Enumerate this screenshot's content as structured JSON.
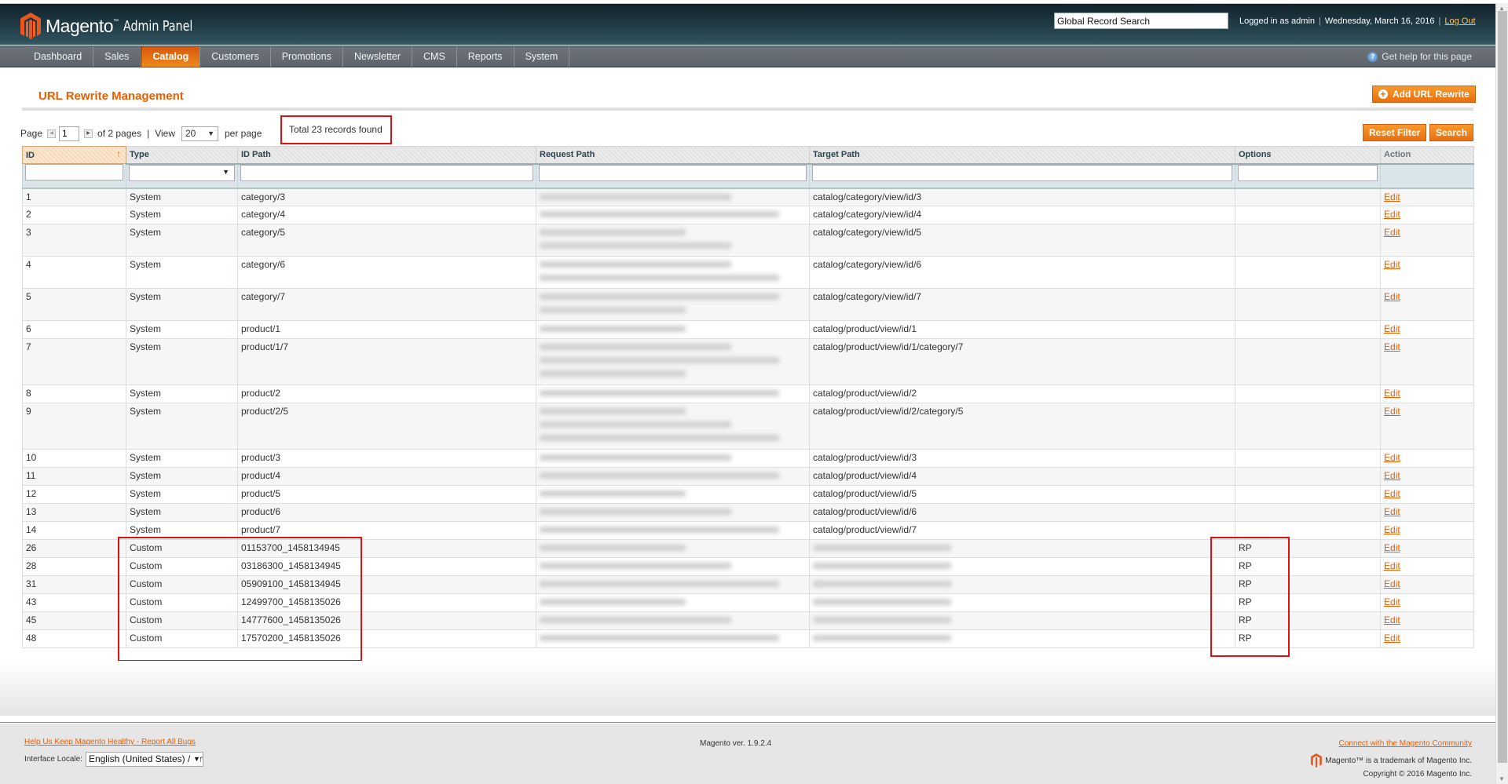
{
  "header": {
    "brand": "Magento",
    "brand_sub": "Admin Panel",
    "global_search_value": "Global Record Search",
    "logged_in": "Logged in as admin",
    "date": "Wednesday, March 16, 2016",
    "logout": "Log Out"
  },
  "nav": {
    "items": [
      {
        "label": "Dashboard"
      },
      {
        "label": "Sales"
      },
      {
        "label": "Catalog",
        "active": true
      },
      {
        "label": "Customers"
      },
      {
        "label": "Promotions"
      },
      {
        "label": "Newsletter"
      },
      {
        "label": "CMS"
      },
      {
        "label": "Reports"
      },
      {
        "label": "System"
      }
    ],
    "help": "Get help for this page"
  },
  "page": {
    "title": "URL Rewrite Management",
    "add_button": "Add URL Rewrite",
    "reset_filter": "Reset Filter",
    "search": "Search"
  },
  "pager": {
    "page_label": "Page",
    "page_value": "1",
    "of_pages": "of 2 pages",
    "view_label": "View",
    "per_page_value": "20",
    "per_page_label": "per page",
    "total": "Total 23 records found"
  },
  "grid": {
    "columns": [
      "ID",
      "Type",
      "ID Path",
      "Request Path",
      "Target Path",
      "Options",
      "Action"
    ],
    "rows": [
      {
        "id": "1",
        "type": "System",
        "id_path": "category/3",
        "request_path": "[blurred]",
        "target_path": "catalog/category/view/id/3",
        "options": "",
        "action": "Edit"
      },
      {
        "id": "2",
        "type": "System",
        "id_path": "category/4",
        "request_path": "[blurred]",
        "target_path": "catalog/category/view/id/4",
        "options": "",
        "action": "Edit"
      },
      {
        "id": "3",
        "type": "System",
        "id_path": "category/5",
        "request_path": "[blurred]",
        "target_path": "catalog/category/view/id/5",
        "options": "",
        "action": "Edit"
      },
      {
        "id": "4",
        "type": "System",
        "id_path": "category/6",
        "request_path": "[blurred]",
        "target_path": "catalog/category/view/id/6",
        "options": "",
        "action": "Edit"
      },
      {
        "id": "5",
        "type": "System",
        "id_path": "category/7",
        "request_path": "[blurred]",
        "target_path": "catalog/category/view/id/7",
        "options": "",
        "action": "Edit"
      },
      {
        "id": "6",
        "type": "System",
        "id_path": "product/1",
        "request_path": "[blurred]",
        "target_path": "catalog/product/view/id/1",
        "options": "",
        "action": "Edit"
      },
      {
        "id": "7",
        "type": "System",
        "id_path": "product/1/7",
        "request_path": "[blurred]",
        "target_path": "catalog/product/view/id/1/category/7",
        "options": "",
        "action": "Edit"
      },
      {
        "id": "8",
        "type": "System",
        "id_path": "product/2",
        "request_path": "[blurred]",
        "target_path": "catalog/product/view/id/2",
        "options": "",
        "action": "Edit"
      },
      {
        "id": "9",
        "type": "System",
        "id_path": "product/2/5",
        "request_path": "[blurred]",
        "target_path": "catalog/product/view/id/2/category/5",
        "options": "",
        "action": "Edit"
      },
      {
        "id": "10",
        "type": "System",
        "id_path": "product/3",
        "request_path": "[blurred]",
        "target_path": "catalog/product/view/id/3",
        "options": "",
        "action": "Edit"
      },
      {
        "id": "11",
        "type": "System",
        "id_path": "product/4",
        "request_path": "[blurred]",
        "target_path": "catalog/product/view/id/4",
        "options": "",
        "action": "Edit"
      },
      {
        "id": "12",
        "type": "System",
        "id_path": "product/5",
        "request_path": "[blurred]",
        "target_path": "catalog/product/view/id/5",
        "options": "",
        "action": "Edit"
      },
      {
        "id": "13",
        "type": "System",
        "id_path": "product/6",
        "request_path": "[blurred]",
        "target_path": "catalog/product/view/id/6",
        "options": "",
        "action": "Edit"
      },
      {
        "id": "14",
        "type": "System",
        "id_path": "product/7",
        "request_path": "[blurred]",
        "target_path": "catalog/product/view/id/7",
        "options": "",
        "action": "Edit"
      },
      {
        "id": "26",
        "type": "Custom",
        "id_path": "01153700_1458134945",
        "request_path": "[blurred]",
        "target_path": "[blurred]",
        "options": "RP",
        "action": "Edit"
      },
      {
        "id": "28",
        "type": "Custom",
        "id_path": "03186300_1458134945",
        "request_path": "[blurred]",
        "target_path": "[blurred]",
        "options": "RP",
        "action": "Edit"
      },
      {
        "id": "31",
        "type": "Custom",
        "id_path": "05909100_1458134945",
        "request_path": "[blurred]",
        "target_path": "[blurred]",
        "options": "RP",
        "action": "Edit"
      },
      {
        "id": "43",
        "type": "Custom",
        "id_path": "12499700_1458135026",
        "request_path": "[blurred]",
        "target_path": "[blurred]",
        "options": "RP",
        "action": "Edit"
      },
      {
        "id": "45",
        "type": "Custom",
        "id_path": "14777600_1458135026",
        "request_path": "[blurred]",
        "target_path": "[blurred]",
        "options": "RP",
        "action": "Edit"
      },
      {
        "id": "48",
        "type": "Custom",
        "id_path": "17570200_1458135026",
        "request_path": "[blurred]",
        "target_path": "[blurred]",
        "options": "RP",
        "action": "Edit"
      }
    ]
  },
  "footer": {
    "bugs_link": "Help Us Keep Magento Healthy - Report All Bugs",
    "locale_label": "Interface Locale:",
    "locale_value": "English (United States) / English",
    "version": "Magento ver. 1.9.2.4",
    "community_link": "Connect with the Magento Community",
    "trademark": "Magento™ is a trademark of Magento Inc.",
    "copyright": "Copyright © 2016 Magento Inc."
  },
  "colors": {
    "accent": "#eb5e00",
    "highlight": "#e01010",
    "header_dark": "#0f2129"
  }
}
